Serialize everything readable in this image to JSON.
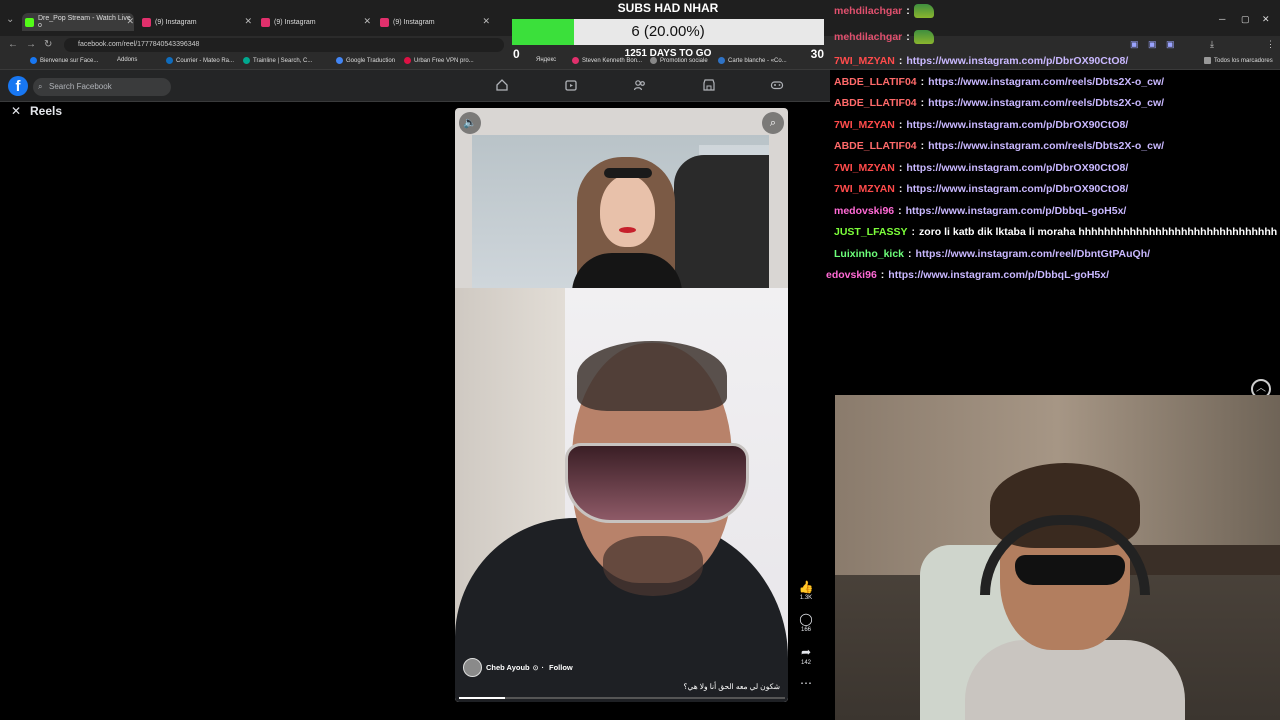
{
  "browser": {
    "tabs": [
      {
        "title": "Dre_Pop Stream - Watch Live o",
        "color": "#53fc18"
      },
      {
        "title": "(9) Instagram",
        "color": "#e1306c"
      },
      {
        "title": "(9) Instagram",
        "color": "#e1306c"
      },
      {
        "title": "(9) Instagram",
        "color": "#e1306c"
      }
    ],
    "url": "facebook.com/reel/1777840543396348",
    "bookmarks": [
      "Bienvenue sur Face...",
      "Addons",
      "Courrier - Mateo Ra...",
      "Trainline | Search, C...",
      "Google Traduction",
      "Urban Free VPN pro...",
      "Яндекс",
      "Steven Kenneth Bon...",
      "Promotion sociale",
      "Carte blanche - «Co...",
      "Todos los marcadores"
    ]
  },
  "facebook": {
    "logo": "f",
    "search_placeholder": "Search Facebook",
    "reels_title": "Reels",
    "nav_icons": [
      "home-icon",
      "video-icon",
      "friends-icon",
      "marketplace-icon",
      "gaming-icon"
    ]
  },
  "reel": {
    "likes": "1.3K",
    "comments": "166",
    "shares": "142",
    "author": "Cheb Ayoub",
    "follow": "Follow",
    "caption": "شكون لي معه الحق أنا ولا هي؟",
    "progress": 0.14
  },
  "subs_goal": {
    "title": "SUBS HAD NHAR",
    "current_label": "6 (20.00%)",
    "current": 6,
    "goal": 30,
    "fraction": 0.2,
    "min_label": "0",
    "max_label": "30",
    "days_label": "1251 DAYS TO GO",
    "fill_color": "#3be03b"
  },
  "chat": [
    {
      "user": "mehdilachgar",
      "sep": ":",
      "msg": "",
      "emote": true,
      "color": "#e0506e"
    },
    {
      "user": "mehdilachgar",
      "sep": ":",
      "msg": "",
      "emote": true,
      "color": "#e0506e"
    },
    {
      "user": "7WI_MZYAN",
      "sep": ":",
      "msg": "https://www.instagram.com/p/DbrOX90CtO8/",
      "emote": false,
      "color": "#ff4b4b"
    },
    {
      "user": "ABDE_LLATIF04",
      "sep": ":",
      "msg": "https://www.instagram.com/reels/Dbts2X-o_cw/",
      "emote": false,
      "color": "#ff6a6a"
    },
    {
      "user": "ABDE_LLATIF04",
      "sep": ":",
      "msg": "https://www.instagram.com/reels/Dbts2X-o_cw/",
      "emote": false,
      "color": "#ff6a6a"
    },
    {
      "user": "7WI_MZYAN",
      "sep": ":",
      "msg": "https://www.instagram.com/p/DbrOX90CtO8/",
      "emote": false,
      "color": "#ff4b4b"
    },
    {
      "user": "ABDE_LLATIF04",
      "sep": ":",
      "msg": "https://www.instagram.com/reels/Dbts2X-o_cw/",
      "emote": false,
      "color": "#ff6a6a"
    },
    {
      "user": "7WI_MZYAN",
      "sep": ":",
      "msg": "https://www.instagram.com/p/DbrOX90CtO8/",
      "emote": false,
      "color": "#ff4b4b"
    },
    {
      "user": "7WI_MZYAN",
      "sep": ":",
      "msg": "https://www.instagram.com/p/DbrOX90CtO8/",
      "emote": false,
      "color": "#ff4b4b"
    },
    {
      "user": "medovski96",
      "sep": ":",
      "msg": "https://www.instagram.com/p/DbbqL-goH5x/",
      "emote": false,
      "color": "#ff6ad5"
    },
    {
      "user": "JUST_LFASSY",
      "sep": ":",
      "msg": "zoro li katb dik lktaba li moraha hhhhhhhhhhhhhhhhhhhhhhhhhhhhhhh",
      "emote": false,
      "color": "#7dff3a",
      "msg_color": "#ffffff"
    },
    {
      "user": "Luixinho_kick",
      "sep": ":",
      "msg": "https://www.instagram.com/reel/DbntGtPAuQh/",
      "emote": false,
      "color": "#6dff7a"
    },
    {
      "user": "edovski96",
      "sep": ":",
      "msg": "https://www.instagram.com/p/DbbqL-goH5x/",
      "emote": false,
      "color": "#ff6ad5"
    }
  ]
}
